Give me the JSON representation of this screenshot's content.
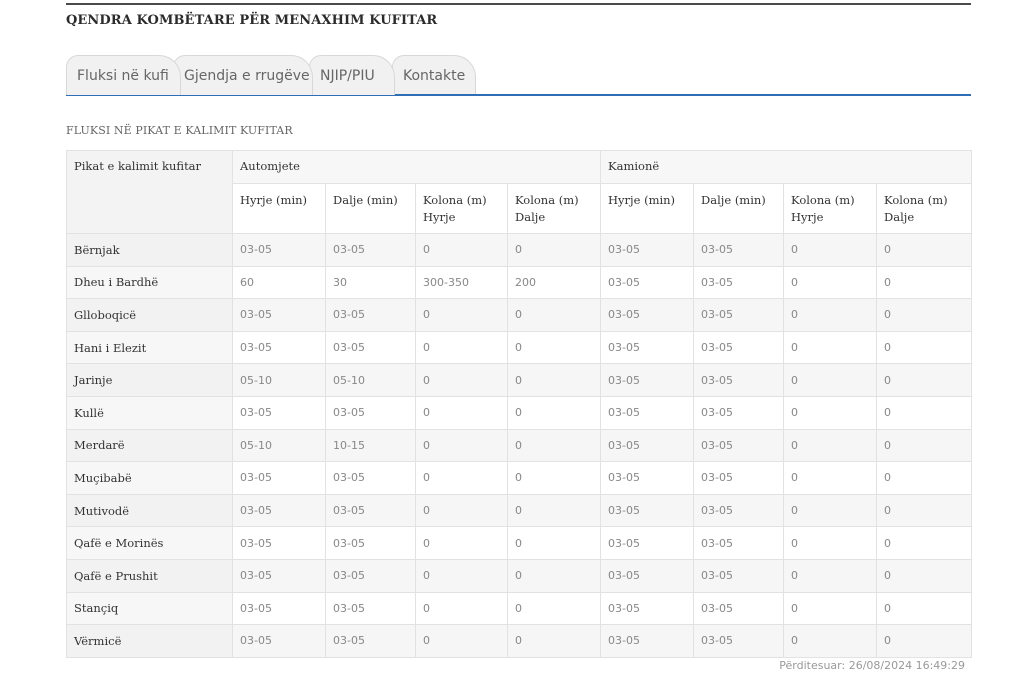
{
  "header": {
    "title": "QENDRA KOMBËTARE PËR MENAXHIM KUFITAR"
  },
  "tabs": [
    {
      "label": "Fluksi në kufi",
      "active": true
    },
    {
      "label": "Gjendja e rrugëve",
      "active": false
    },
    {
      "label": "NJIP/PIU",
      "active": false
    },
    {
      "label": "Kontakte",
      "active": false
    }
  ],
  "section": {
    "heading": "FLUKSI NË PIKAT E KALIMIT KUFITAR"
  },
  "table": {
    "place_header": "Pikat e kalimit kufitar",
    "groups": [
      "Automjete",
      "Kamionë"
    ],
    "subheaders": [
      [
        "Hyrje (min)"
      ],
      [
        "Dalje (min)"
      ],
      [
        "Kolona (m)",
        "Hyrje"
      ],
      [
        "Kolona (m)",
        "Dalje"
      ],
      [
        "Hyrje (min)"
      ],
      [
        "Dalje (min)"
      ],
      [
        "Kolona (m)",
        "Hyrje"
      ],
      [
        "Kolona (m)",
        "Dalje"
      ]
    ],
    "rows": [
      {
        "place": "Bërnjak",
        "values": [
          "03-05",
          "03-05",
          "0",
          "0",
          "03-05",
          "03-05",
          "0",
          "0"
        ]
      },
      {
        "place": "Dheu i Bardhë",
        "values": [
          "60",
          "30",
          "300-350",
          "200",
          "03-05",
          "03-05",
          "0",
          "0"
        ]
      },
      {
        "place": "Glloboqicë",
        "values": [
          "03-05",
          "03-05",
          "0",
          "0",
          "03-05",
          "03-05",
          "0",
          "0"
        ]
      },
      {
        "place": "Hani i Elezit",
        "values": [
          "03-05",
          "03-05",
          "0",
          "0",
          "03-05",
          "03-05",
          "0",
          "0"
        ]
      },
      {
        "place": "Jarinje",
        "values": [
          "05-10",
          "05-10",
          "0",
          "0",
          "03-05",
          "03-05",
          "0",
          "0"
        ]
      },
      {
        "place": "Kullë",
        "values": [
          "03-05",
          "03-05",
          "0",
          "0",
          "03-05",
          "03-05",
          "0",
          "0"
        ]
      },
      {
        "place": "Merdarë",
        "values": [
          "05-10",
          "10-15",
          "0",
          "0",
          "03-05",
          "03-05",
          "0",
          "0"
        ]
      },
      {
        "place": "Muçibabë",
        "values": [
          "03-05",
          "03-05",
          "0",
          "0",
          "03-05",
          "03-05",
          "0",
          "0"
        ]
      },
      {
        "place": "Mutivodë",
        "values": [
          "03-05",
          "03-05",
          "0",
          "0",
          "03-05",
          "03-05",
          "0",
          "0"
        ]
      },
      {
        "place": "Qafë e Morinës",
        "values": [
          "03-05",
          "03-05",
          "0",
          "0",
          "03-05",
          "03-05",
          "0",
          "0"
        ]
      },
      {
        "place": "Qafë e Prushit",
        "values": [
          "03-05",
          "03-05",
          "0",
          "0",
          "03-05",
          "03-05",
          "0",
          "0"
        ]
      },
      {
        "place": "Stançiq",
        "values": [
          "03-05",
          "03-05",
          "0",
          "0",
          "03-05",
          "03-05",
          "0",
          "0"
        ]
      },
      {
        "place": "Vërmicë",
        "values": [
          "03-05",
          "03-05",
          "0",
          "0",
          "03-05",
          "03-05",
          "0",
          "0"
        ]
      }
    ]
  },
  "footer": {
    "updated": "Përditesuar: 26/08/2024 16:49:29"
  },
  "colors": {
    "accent": "#2f6db5",
    "tab_inactive": "#f1f1f1",
    "row_alt": "#f6f6f6"
  }
}
